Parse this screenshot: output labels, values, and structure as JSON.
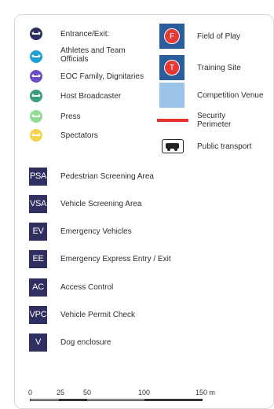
{
  "entrances": [
    {
      "label": "Entrance/Exit:",
      "color": "#2f3061"
    },
    {
      "label": "Athletes and Team Officials",
      "color": "#1ea0d6"
    },
    {
      "label": "EOC Family, Dignitaries",
      "color": "#6a4fc4"
    },
    {
      "label": "Host Broadcaster",
      "color": "#3a9d7c"
    },
    {
      "label": "Press",
      "color": "#8fdc8f"
    },
    {
      "label": "Spectators",
      "color": "#f4d34a"
    }
  ],
  "symbols": {
    "field_of_play": {
      "letter": "F",
      "label": "Field of Play"
    },
    "training_site": {
      "letter": "T",
      "label": "Training Site"
    },
    "competition_venue": {
      "label": "Competition Venue",
      "color": "#9bc4e8"
    },
    "security_perimeter": {
      "label": "Security Perimeter",
      "color": "#e8342f"
    },
    "public_transport": {
      "label": "Public transport",
      "icon": "bus-icon"
    }
  },
  "abbreviations": [
    {
      "code": "PSA",
      "label": "Pedestrian Screening Area"
    },
    {
      "code": "VSA",
      "label": "Vehicle Screening Area"
    },
    {
      "code": "EV",
      "label": "Emergency Vehicles"
    },
    {
      "code": "EE",
      "label": "Emergency Express Entry / Exit"
    },
    {
      "code": "AC",
      "label": "Access Control"
    },
    {
      "code": "VPC",
      "label": "Vehicle Permit Check"
    },
    {
      "code": "V",
      "label": "Dog enclosure"
    }
  ],
  "scale": {
    "ticks": [
      "0",
      "25",
      "50",
      "100",
      "150 m"
    ]
  }
}
